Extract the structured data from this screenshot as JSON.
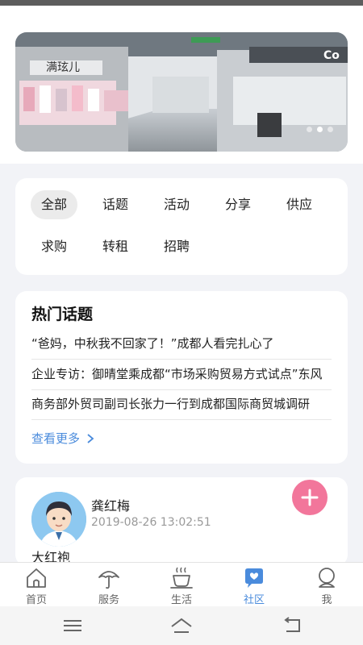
{
  "banner": {
    "shop_sign": "满玹儿",
    "shop_sign_2": "Co",
    "slide_count": 3,
    "active_slide": 2
  },
  "categories": [
    {
      "label": "全部",
      "active": true
    },
    {
      "label": "话题",
      "active": false
    },
    {
      "label": "活动",
      "active": false
    },
    {
      "label": "分享",
      "active": false
    },
    {
      "label": "供应",
      "active": false
    },
    {
      "label": "求购",
      "active": false
    },
    {
      "label": "转租",
      "active": false
    },
    {
      "label": "招聘",
      "active": false
    }
  ],
  "hot_topics": {
    "title": "热门话题",
    "items": [
      "“爸妈，中秋我不回家了！”成都人看完扎心了",
      "企业专访：御晴堂乘成都“市场采购贸易方式试点”东风",
      "商务部外贸司副司长张力一行到成都国际商贸城调研"
    ],
    "more_label": "查看更多"
  },
  "post": {
    "author": "龚红梅",
    "time": "2019-08-26 13:02:51",
    "title": "大红袍"
  },
  "fab_icon": "plus-icon",
  "tabs": [
    {
      "label": "首页",
      "icon": "home-icon",
      "active": false
    },
    {
      "label": "服务",
      "icon": "umbrella-icon",
      "active": false
    },
    {
      "label": "生活",
      "icon": "coffee-cup-icon",
      "active": false
    },
    {
      "label": "社区",
      "icon": "chat-bubble-icon",
      "active": true
    },
    {
      "label": "我",
      "icon": "profile-icon",
      "active": false
    }
  ],
  "colors": {
    "accent": "#4a8bdc",
    "fab": "#f2769b",
    "background": "#f2f3f7"
  }
}
